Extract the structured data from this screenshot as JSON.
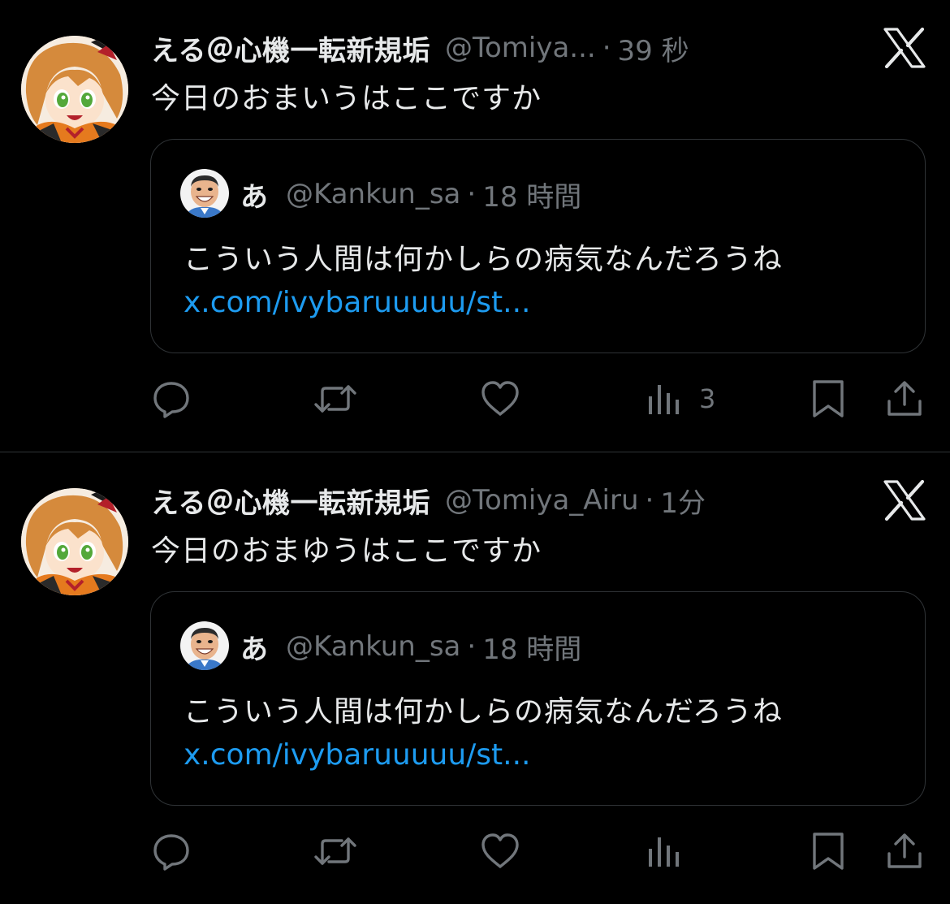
{
  "tweets": [
    {
      "author_name": "える＠心機一転新規垢",
      "handle": "@Tomiya...",
      "separator": "·",
      "time": "39 秒",
      "text": "今日のおまいうはここですか",
      "quote": {
        "author_name": "あ",
        "handle": "@Kankun_sa",
        "separator": "·",
        "time": "18 時間",
        "text": "こういう人間は何かしらの病気なんだろうね",
        "link": "x.com/ivybaruuuuu/st..."
      },
      "actions": {
        "views_count": "3"
      }
    },
    {
      "author_name": "える＠心機一転新規垢",
      "handle": "@Tomiya_Airu",
      "separator": "·",
      "time": "1分",
      "text": "今日のおまゆうはここですか",
      "quote": {
        "author_name": "あ",
        "handle": "@Kankun_sa",
        "separator": "·",
        "time": "18 時間",
        "text": "こういう人間は何かしらの病気なんだろうね",
        "link": "x.com/ivybaruuuuu/st..."
      },
      "actions": {
        "views_count": ""
      }
    }
  ],
  "icons": {
    "platform_logo": "x-logo-icon",
    "reply": "reply-icon",
    "repost": "repost-icon",
    "like": "heart-icon",
    "views": "views-icon",
    "bookmark": "bookmark-icon",
    "share": "share-icon"
  },
  "colors": {
    "background": "#000000",
    "primary_text": "#e7e9ea",
    "secondary_text": "#71767b",
    "link": "#1d9bf0",
    "border": "#2f3336"
  }
}
